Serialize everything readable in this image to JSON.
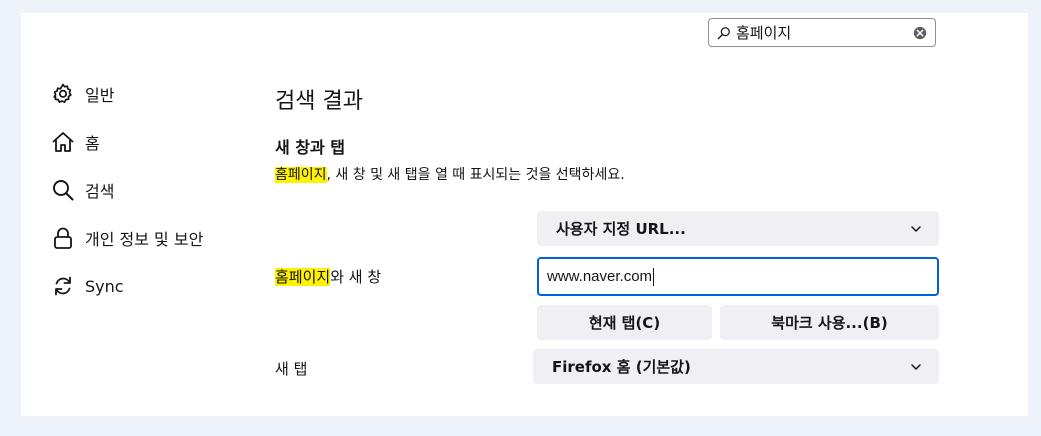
{
  "search": {
    "value": "홈페이지",
    "search_icon": "search-icon",
    "clear_icon": "clear-icon"
  },
  "sidebar": {
    "items": [
      {
        "label": "일반",
        "icon": "gear-icon"
      },
      {
        "label": "홈",
        "icon": "home-icon"
      },
      {
        "label": "검색",
        "icon": "search-icon"
      },
      {
        "label": "개인 정보 및 보안",
        "icon": "lock-icon"
      },
      {
        "label": "Sync",
        "icon": "sync-icon"
      }
    ]
  },
  "main": {
    "title": "검색 결과",
    "section_title": "새 창과 탭",
    "desc_highlight": "홈페이지",
    "desc_rest": ", 새 창 및 새 탭을 열 때 표시되는 것을 선택하세요.",
    "homepage_label_highlight": "홈페이지",
    "homepage_label_rest": "와 새 창",
    "homepage_select": "사용자 지정 URL...",
    "url_value": "www.naver.com",
    "current_tab_button": "현재 탭(C)",
    "bookmark_button": "북마크 사용...(B)",
    "newtab_label": "새 탭",
    "newtab_select": "Firefox 홈 (기본값)"
  },
  "colors": {
    "highlight": "#fff200",
    "focus_border": "#0061e0",
    "button_bg": "#f0f0f4",
    "page_bg": "#eef2f9"
  }
}
